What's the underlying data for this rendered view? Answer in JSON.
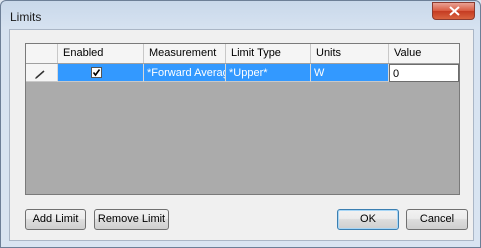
{
  "window": {
    "title": "Limits"
  },
  "grid": {
    "columns": [
      "",
      "Enabled",
      "Measurement",
      "Limit Type",
      "Units",
      "Value"
    ],
    "rows": [
      {
        "row_marker": "pencil",
        "enabled": true,
        "measurement": "*Forward Average*",
        "limit_type": "*Upper*",
        "units": "W",
        "value": "0"
      }
    ]
  },
  "buttons": {
    "add_limit": "Add Limit",
    "remove_limit": "Remove Limit",
    "ok": "OK",
    "cancel": "Cancel"
  },
  "colors": {
    "selection": "#3399ff",
    "grid_background": "#ababab",
    "close_button": "#c53b22"
  }
}
